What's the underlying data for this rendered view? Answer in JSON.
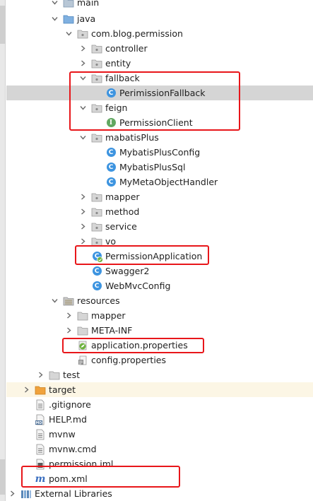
{
  "tree": {
    "items": [
      {
        "label": "main",
        "icon": "folder-icon"
      },
      {
        "label": "java",
        "icon": "source-folder-icon"
      },
      {
        "label": "com.blog.permission",
        "icon": "package-icon"
      },
      {
        "label": "controller",
        "icon": "package-icon"
      },
      {
        "label": "entity",
        "icon": "package-icon"
      },
      {
        "label": "fallback",
        "icon": "package-icon"
      },
      {
        "label": "PerimissionFallback",
        "icon": "class-icon"
      },
      {
        "label": "feign",
        "icon": "package-icon"
      },
      {
        "label": "PermissionClient",
        "icon": "interface-icon"
      },
      {
        "label": "mabatisPlus",
        "icon": "package-icon"
      },
      {
        "label": "MybatisPlusConfig",
        "icon": "class-icon"
      },
      {
        "label": "MybatisPlusSql",
        "icon": "class-icon"
      },
      {
        "label": "MyMetaObjectHandler",
        "icon": "class-icon"
      },
      {
        "label": "mapper",
        "icon": "package-icon"
      },
      {
        "label": "method",
        "icon": "package-icon"
      },
      {
        "label": "service",
        "icon": "package-icon"
      },
      {
        "label": "vo",
        "icon": "package-icon"
      },
      {
        "label": "PermissionApplication",
        "icon": "spring-boot-class-icon"
      },
      {
        "label": "Swagger2",
        "icon": "class-icon"
      },
      {
        "label": "WebMvcConfig",
        "icon": "class-icon"
      },
      {
        "label": "resources",
        "icon": "resources-folder-icon"
      },
      {
        "label": "mapper",
        "icon": "folder-icon"
      },
      {
        "label": "META-INF",
        "icon": "folder-icon"
      },
      {
        "label": "application.properties",
        "icon": "spring-properties-icon"
      },
      {
        "label": "config.properties",
        "icon": "properties-file-icon"
      },
      {
        "label": "test",
        "icon": "folder-icon"
      },
      {
        "label": "target",
        "icon": "excluded-folder-icon"
      },
      {
        "label": ".gitignore",
        "icon": "text-file-icon"
      },
      {
        "label": "HELP.md",
        "icon": "markdown-file-icon"
      },
      {
        "label": "mvnw",
        "icon": "text-file-icon"
      },
      {
        "label": "mvnw.cmd",
        "icon": "text-file-icon"
      },
      {
        "label": "permission.iml",
        "icon": "iml-file-icon"
      },
      {
        "label": "pom.xml",
        "icon": "maven-icon"
      },
      {
        "label": "External Libraries",
        "icon": "libraries-icon"
      }
    ],
    "selected": "PerimissionFallback"
  },
  "colors": {
    "highlight_box": "#e8161a",
    "selection_bg": "#d5d5d5",
    "folder": "#8fb4d9",
    "excluded_folder": "#f0a23c",
    "class_icon": "#3d94e0",
    "interface_icon": "#61a861"
  }
}
